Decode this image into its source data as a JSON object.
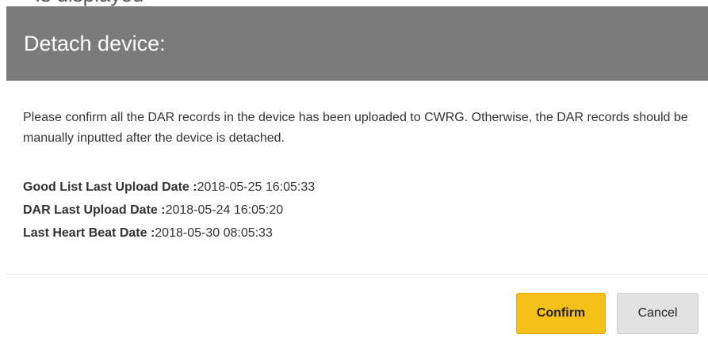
{
  "background_text": "Is displayed",
  "dialog": {
    "title": "Detach device:",
    "message": "Please confirm all the DAR records in the device has been uploaded to CWRG. Otherwise, the DAR records should be manually inputted after the device is detached.",
    "info": [
      {
        "label": "Good List Last Upload Date :",
        "value": "2018-05-25 16:05:33"
      },
      {
        "label": "DAR Last Upload Date :",
        "value": "2018-05-24 16:05:20"
      },
      {
        "label": "Last Heart Beat Date :",
        "value": "2018-05-30 08:05:33"
      }
    ],
    "buttons": {
      "confirm_label": "Confirm",
      "cancel_label": "Cancel"
    }
  },
  "colors": {
    "header_bg": "#7b7b7b",
    "confirm_bg": "#f5c018",
    "cancel_bg": "#e2e2e2"
  }
}
